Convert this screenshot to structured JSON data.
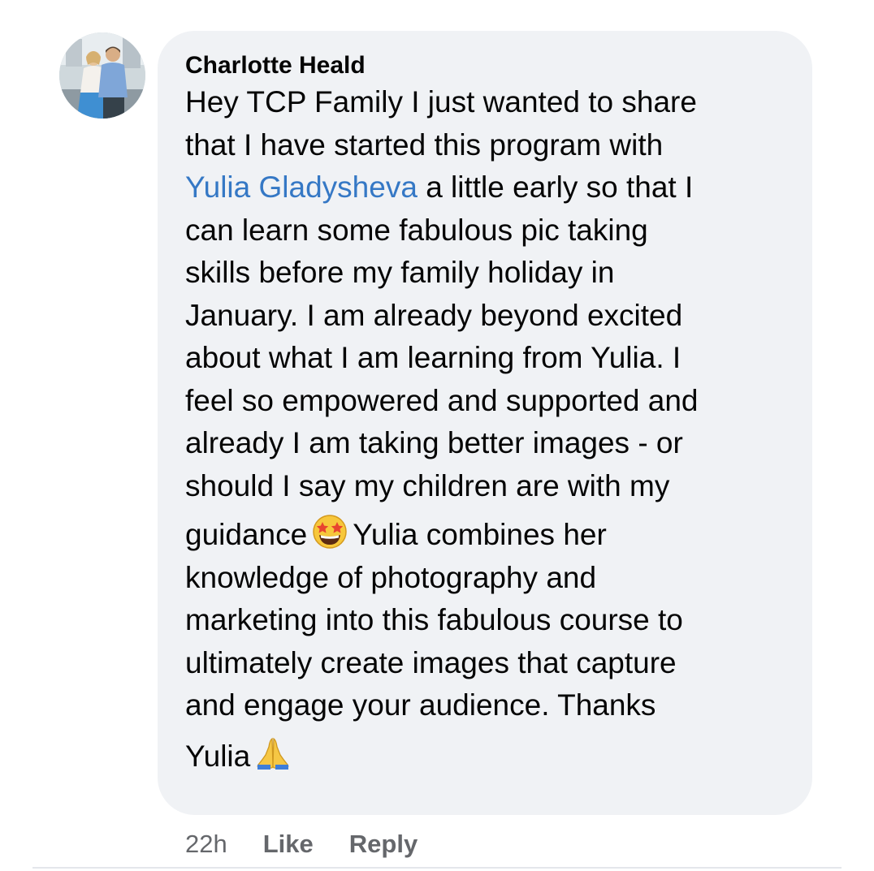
{
  "comment": {
    "author": "Charlotte Heald",
    "lines": [
      [
        "Hey TCP Family I just wanted to share"
      ],
      [
        "that I have started this program with"
      ],
      [
        "a little early so that I"
      ],
      [
        "can learn some fabulous pic taking"
      ],
      [
        "skills before my family holiday in"
      ],
      [
        "January. I am already beyond excited"
      ],
      [
        "about what I am learning from Yulia. I"
      ],
      [
        "feel so empowered and supported and"
      ],
      [
        "already I am taking better images - or"
      ],
      [
        "should I say my children are with my"
      ],
      [
        "guidance",
        "Yulia combines her"
      ],
      [
        "knowledge of photography and"
      ],
      [
        "marketing into this fabulous course to"
      ],
      [
        "ultimately create images that capture"
      ],
      [
        "and engage your audience. Thanks"
      ],
      [
        "Yulia"
      ]
    ],
    "mention": "Yulia Gladysheva",
    "emojis": {
      "star_struck": "star-struck-emoji",
      "folded_hands": "folded-hands-emoji"
    }
  },
  "actions": {
    "time": "22h",
    "like": "Like",
    "reply": "Reply"
  },
  "colors": {
    "bubble": "#f0f2f5",
    "mention": "#3578c5",
    "meta": "#65676b"
  }
}
